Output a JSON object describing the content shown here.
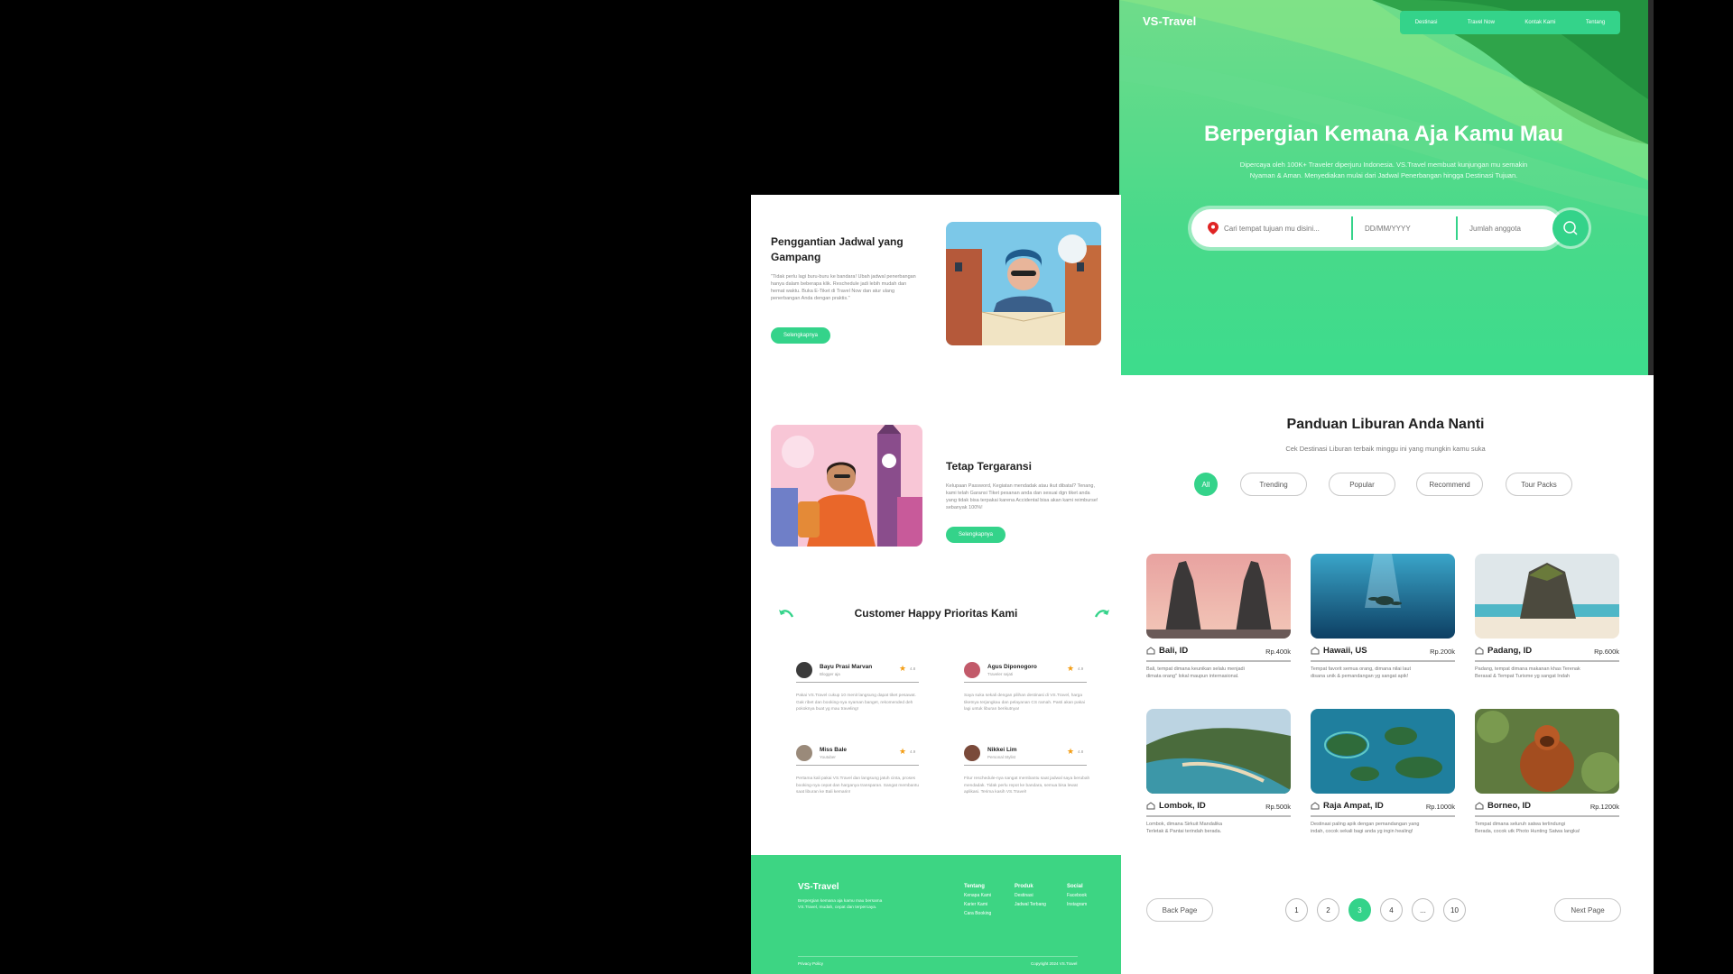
{
  "brand": {
    "name": "VS-Travel",
    "accent": "#34d38a"
  },
  "nav": [
    {
      "label": "Destinasi"
    },
    {
      "label": "Travel Now"
    },
    {
      "label": "Kontak Kami"
    },
    {
      "label": "Tentang"
    }
  ],
  "hero": {
    "title": "Berpergian Kemana Aja Kamu Mau",
    "subtitle_line1": "Dipercaya oleh 100K+ Traveler diperjuru Indonesia. VS.Travel membuat kunjungan mu semakin",
    "subtitle_line2": "Nyaman & Aman. Menyediakan mulai dari Jadwal Penerbangan hingga Destinasi Tujuan.",
    "search": {
      "destination_placeholder": "Cari tempat tujuan mu disini...",
      "date_placeholder": "DD/MM/YYYY",
      "members_placeholder": "Jumlah anggota"
    }
  },
  "guide": {
    "title": "Panduan Liburan Anda Nanti",
    "subtitle": "Cek Destinasi Liburan terbaik minggu ini yang mungkin kamu suka",
    "filters": [
      {
        "label": "All"
      },
      {
        "label": "Trending"
      },
      {
        "label": "Popular"
      },
      {
        "label": "Recommend"
      },
      {
        "label": "Tour Packs"
      }
    ]
  },
  "destinations": [
    {
      "name": "Bali, ID",
      "price": "Rp.400k",
      "desc1": "Bali, tempat dimana keunikan selalu menjadi",
      "desc2": "dimata orang\" lokal maupun internasional."
    },
    {
      "name": "Hawaii, US",
      "price": "Rp.200k",
      "desc1": "Tempat favorit semua orang, dimana nilai laut",
      "desc2": "disana unik & pemandangan yg sangat apik!"
    },
    {
      "name": "Padang, ID",
      "price": "Rp.600k",
      "desc1": "Padang, tempat dimana makanan khas Terenak",
      "desc2": "Berasal & Tempat Turisme yg sangat Indah"
    },
    {
      "name": "Lombok, ID",
      "price": "Rp.500k",
      "desc1": "Lombok, dimana Sirkuit Mandalika",
      "desc2": "Terletak & Pantai terindah berada."
    },
    {
      "name": "Raja Ampat, ID",
      "price": "Rp.1000k",
      "desc1": "Destinasi paling apik dengan pemandangan yang",
      "desc2": "indah, cocok sekali bagi anda yg ingin healing!"
    },
    {
      "name": "Borneo, ID",
      "price": "Rp.1200k",
      "desc1": "Tempat dimana seluruh satwa terlindungi",
      "desc2": "Berada, cocok utk Photo Hunting Satwa langka!"
    }
  ],
  "pagination": {
    "back": "Back Page",
    "next": "Next Page",
    "pages": [
      "1",
      "2",
      "3",
      "4",
      "...",
      "10"
    ],
    "current": "3"
  },
  "features": [
    {
      "title_line1": "Penggantian Jadwal yang",
      "title_line2": "Gampang",
      "text": "\"Tidak perlu lagi buru-buru ke bandara! Ubah jadwal penerbangan hanya dalam beberapa klik. Reschedule jadi lebih mudah dan hemat waktu. Buka E-Tiket di Travel Now dan atur ulang penerbangan Anda dengan praktis.\"",
      "button": "Selengkapnya"
    },
    {
      "title_line1": "Tetap Tergaransi",
      "title_line2": "",
      "text": "Kelupaan Password, Kegiatan mendadak atau ikut dibatal? Tenang, kami telah Garansi Tiket pesanan anda dan sesuai dgn tiket anda yang tidak bisa terpakai karena Accidental bisa akan kami reimburse! sebanyak 100%!",
      "button": "Selengkapnya"
    }
  ],
  "testimonials": {
    "title": "Customer Happy Prioritas Kami",
    "items": [
      {
        "name": "Bayu Prasi Marvan",
        "role": "Blogger aja",
        "rating": "4.8",
        "text": "Pakai VS.Travel cukup 10 menit langsung dapat tiket pesawat. Gak ribet dan booking-nya nyaman banget, rekomended deh pokoknya buat yg mau traveling!"
      },
      {
        "name": "Agus Diponogoro",
        "role": "Traveler sejati",
        "rating": "4.9",
        "text": "Saya suka sekali dengan pilihan destinasi di VS.Travel, harga tiketnya terjangkau dan pelayanan CS ramah. Pasti akan pakai lagi untuk liburan berikutnya!"
      },
      {
        "name": "Miss Bale",
        "role": "Youtuber",
        "rating": "4.9",
        "text": "Pertama kali pakai VS.Travel dan langsung jatuh cinta, proses booking-nya cepat dan harganya transparan. Sangat membantu saat liburan ke Bali kemarin!"
      },
      {
        "name": "Nikkei Lim",
        "role": "Personal Stylist",
        "rating": "4.8",
        "text": "Fitur reschedule-nya sangat membantu saat jadwal saya berubah mendadak. Tidak perlu repot ke bandara, semua bisa lewat aplikasi. Terima kasih VS.Travel!"
      }
    ]
  },
  "footer": {
    "brand": "VS-Travel",
    "text": "Berpergian kemana aja kamu mau bersama VS.Travel, mudah, cepat dan terpercaya.",
    "cols": [
      {
        "title": "Tentang",
        "items": [
          "Kenapa Kami",
          "Karier Kami",
          "Cara Booking"
        ]
      },
      {
        "title": "Produk",
        "items": [
          "Destinasi",
          "Jadwal Terbang"
        ]
      },
      {
        "title": "Social",
        "items": [
          "Facebook",
          "Instagram"
        ]
      }
    ],
    "policy": "Privacy Policy",
    "copyright": "Copyright 2024 VS.Travel"
  }
}
